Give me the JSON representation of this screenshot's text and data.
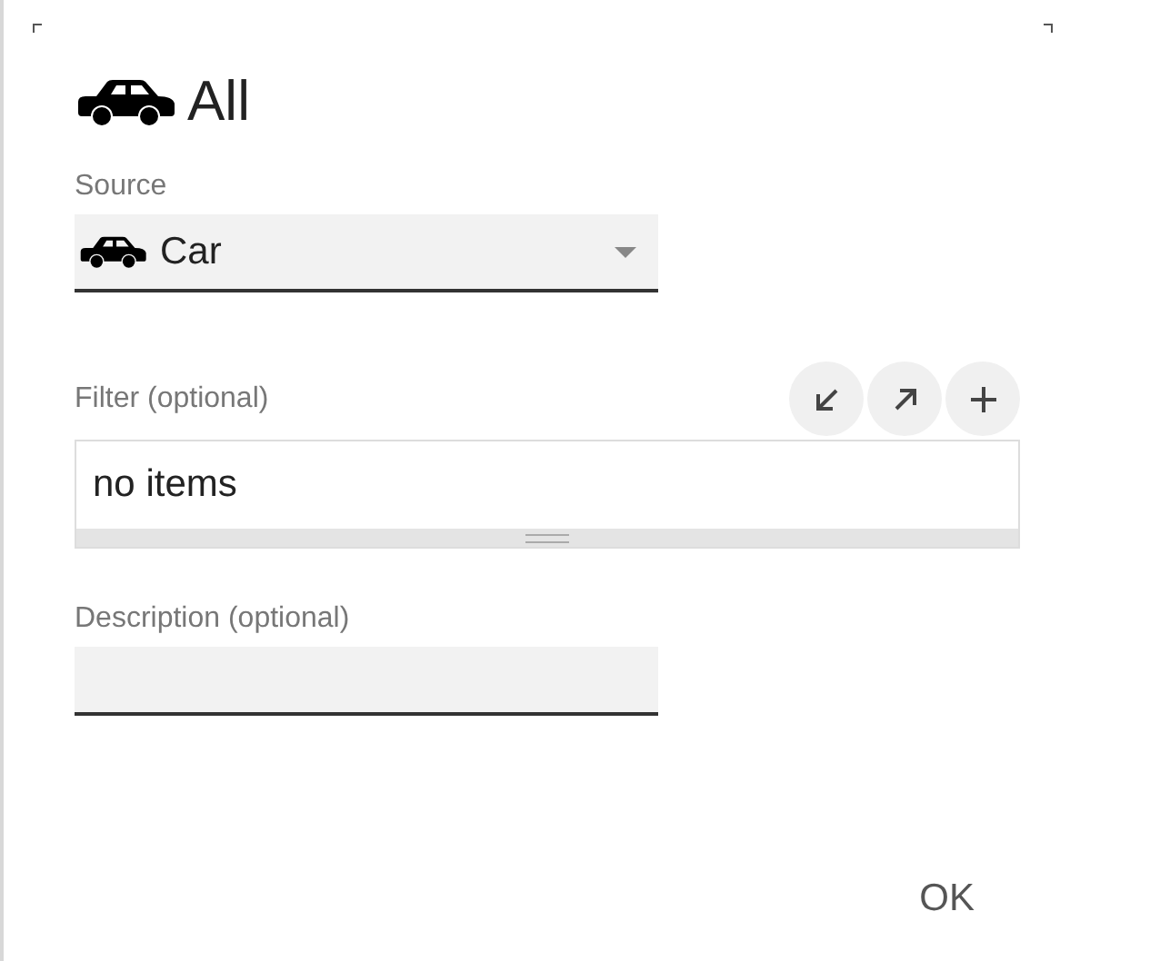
{
  "title": "All",
  "source": {
    "label": "Source",
    "value": "Car"
  },
  "filter": {
    "label": "Filter (optional)",
    "buttons": [
      {
        "kind": "collapse"
      },
      {
        "kind": "expand"
      },
      {
        "kind": "add"
      }
    ],
    "list_text": "no items"
  },
  "description": {
    "label": "Description (optional)"
  },
  "buttons": [
    "OK"
  ]
}
